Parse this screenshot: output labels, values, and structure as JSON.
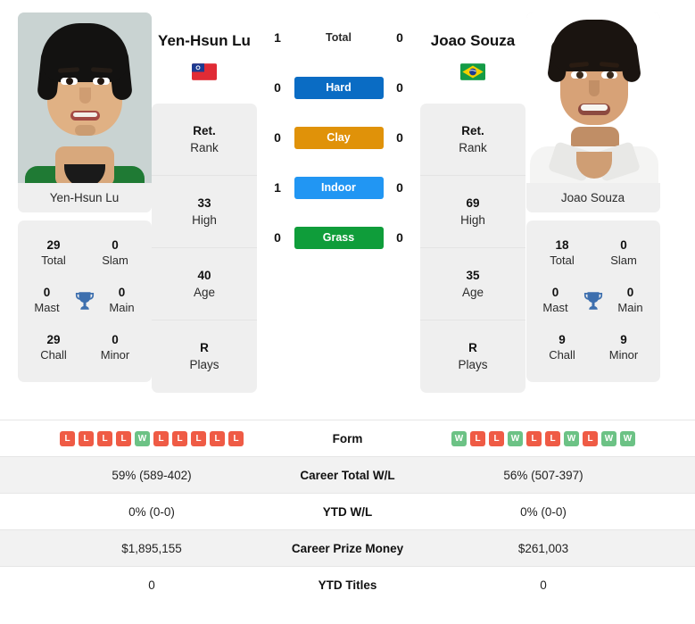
{
  "players": {
    "left": {
      "name": "Yen-Hsun Lu",
      "photo_caption": "Yen-Hsun Lu",
      "flag": "taiwan-flag",
      "info": [
        {
          "value": "Ret.",
          "label": "Rank"
        },
        {
          "value": "33",
          "label": "High"
        },
        {
          "value": "40",
          "label": "Age"
        },
        {
          "value": "R",
          "label": "Plays"
        }
      ],
      "titles": [
        {
          "value": "29",
          "label": "Total"
        },
        {
          "value": "0",
          "label": "Slam"
        },
        {
          "value": "0",
          "label": "Mast"
        },
        {
          "value": "0",
          "label": "Main"
        },
        {
          "value": "29",
          "label": "Chall"
        },
        {
          "value": "0",
          "label": "Minor"
        }
      ],
      "form": [
        "L",
        "L",
        "L",
        "L",
        "W",
        "L",
        "L",
        "L",
        "L",
        "L"
      ],
      "career_total_wl": "59% (589-402)",
      "ytd_wl": "0% (0-0)",
      "career_prize_money": "$1,895,155",
      "ytd_titles": "0"
    },
    "right": {
      "name": "Joao Souza",
      "photo_caption": "Joao Souza",
      "flag": "brazil-flag",
      "info": [
        {
          "value": "Ret.",
          "label": "Rank"
        },
        {
          "value": "69",
          "label": "High"
        },
        {
          "value": "35",
          "label": "Age"
        },
        {
          "value": "R",
          "label": "Plays"
        }
      ],
      "titles": [
        {
          "value": "18",
          "label": "Total"
        },
        {
          "value": "0",
          "label": "Slam"
        },
        {
          "value": "0",
          "label": "Mast"
        },
        {
          "value": "0",
          "label": "Main"
        },
        {
          "value": "9",
          "label": "Chall"
        },
        {
          "value": "9",
          "label": "Minor"
        }
      ],
      "form": [
        "W",
        "L",
        "L",
        "W",
        "L",
        "L",
        "W",
        "L",
        "W",
        "W"
      ],
      "career_total_wl": "56% (507-397)",
      "ytd_wl": "0% (0-0)",
      "career_prize_money": "$261,003",
      "ytd_titles": "0"
    }
  },
  "head_to_head": [
    {
      "label": "Total",
      "left": "1",
      "right": "0",
      "surface": false,
      "color": ""
    },
    {
      "label": "Hard",
      "left": "0",
      "right": "0",
      "surface": true,
      "color": "#0a6cc4"
    },
    {
      "label": "Clay",
      "left": "0",
      "right": "0",
      "surface": true,
      "color": "#e09209"
    },
    {
      "label": "Indoor",
      "left": "1",
      "right": "0",
      "surface": true,
      "color": "#2196f3"
    },
    {
      "label": "Grass",
      "left": "0",
      "right": "0",
      "surface": true,
      "color": "#0f9d3a"
    }
  ],
  "table_rows": [
    {
      "label": "Form",
      "type": "form",
      "left": "",
      "right": ""
    },
    {
      "label": "Career Total W/L",
      "type": "text",
      "left": "59% (589-402)",
      "right": "56% (507-397)"
    },
    {
      "label": "YTD W/L",
      "type": "text",
      "left": "0% (0-0)",
      "right": "0% (0-0)"
    },
    {
      "label": "Career Prize Money",
      "type": "text",
      "left": "$1,895,155",
      "right": "$261,003"
    },
    {
      "label": "YTD Titles",
      "type": "text",
      "left": "0",
      "right": "0"
    }
  ],
  "colors": {
    "win_badge": "#6cc285",
    "loss_badge": "#ef5b45",
    "card_bg": "#efefef",
    "row_alt_bg": "#f2f2f2",
    "trophy": "#3d6fae"
  }
}
